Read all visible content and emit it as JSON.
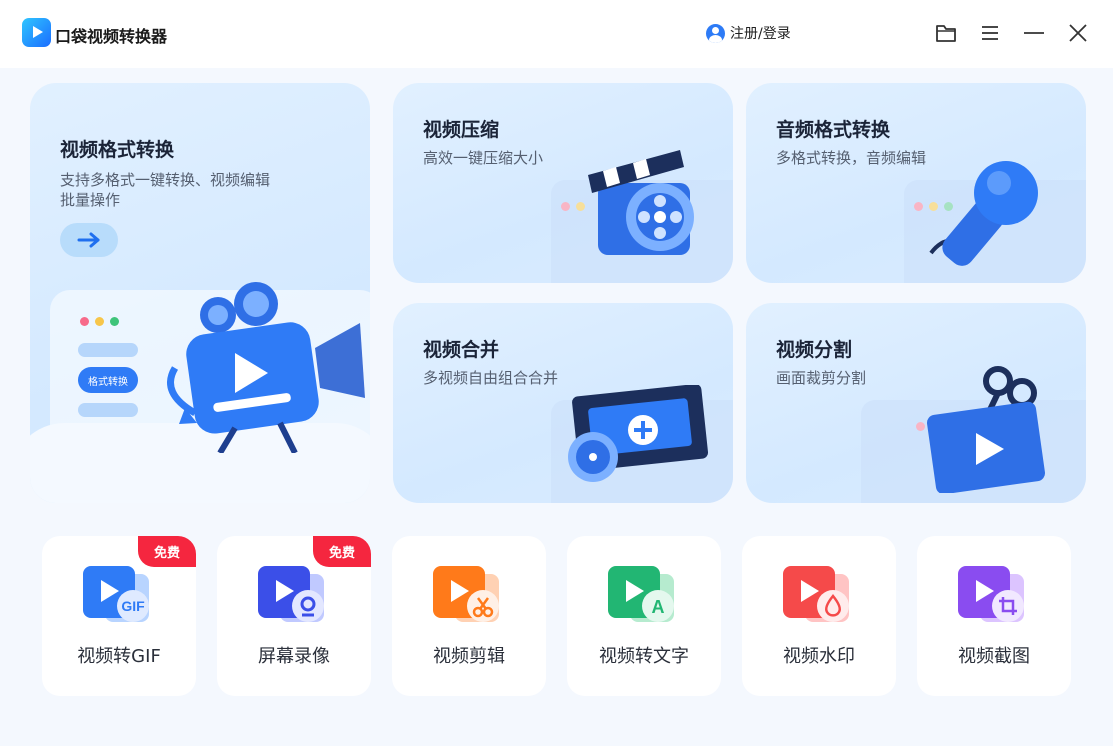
{
  "app": {
    "title": "口袋视频转换器"
  },
  "header": {
    "login_label": "注册/登录"
  },
  "cards": {
    "format": {
      "title": "视频格式转换",
      "subtitle_line1": "支持多格式一键转换、视频编辑",
      "subtitle_line2": "批量操作",
      "tag_label": "格式转换"
    },
    "compress": {
      "title": "视频压缩",
      "subtitle": "高效一键压缩大小"
    },
    "audio": {
      "title": "音频格式转换",
      "subtitle": "多格式转换，音频编辑"
    },
    "merge": {
      "title": "视频合并",
      "subtitle": "多视频自由组合合并"
    },
    "split": {
      "title": "视频分割",
      "subtitle": "画面裁剪分割"
    }
  },
  "tools": [
    {
      "label": "视频转GIF",
      "badge": "免费",
      "icon": "gif-icon",
      "color": "#2f7bf6"
    },
    {
      "label": "屏幕录像",
      "badge": "免费",
      "icon": "screen-record-icon",
      "color": "#3b5cf0"
    },
    {
      "label": "视频剪辑",
      "icon": "scissors-icon",
      "color": "#ff7a1a"
    },
    {
      "label": "视频转文字",
      "icon": "text-icon",
      "color": "#22b673"
    },
    {
      "label": "视频水印",
      "icon": "watermark-icon",
      "color": "#f54a4a"
    },
    {
      "label": "视频截图",
      "icon": "crop-icon",
      "color": "#8a4cf0"
    }
  ],
  "colors": {
    "accent": "#1f6fef",
    "badge": "#f5263f",
    "card_bg": "#d9ecff",
    "page_bg": "#f4f8fe"
  }
}
